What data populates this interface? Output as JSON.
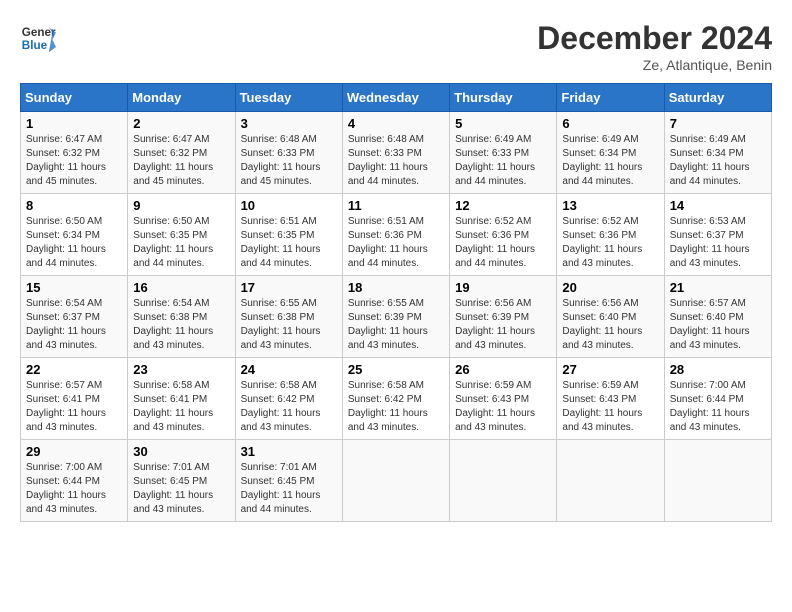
{
  "header": {
    "logo_line1": "General",
    "logo_line2": "Blue",
    "month_title": "December 2024",
    "subtitle": "Ze, Atlantique, Benin"
  },
  "days_of_week": [
    "Sunday",
    "Monday",
    "Tuesday",
    "Wednesday",
    "Thursday",
    "Friday",
    "Saturday"
  ],
  "weeks": [
    [
      {
        "day": "1",
        "detail": "Sunrise: 6:47 AM\nSunset: 6:32 PM\nDaylight: 11 hours\nand 45 minutes."
      },
      {
        "day": "2",
        "detail": "Sunrise: 6:47 AM\nSunset: 6:32 PM\nDaylight: 11 hours\nand 45 minutes."
      },
      {
        "day": "3",
        "detail": "Sunrise: 6:48 AM\nSunset: 6:33 PM\nDaylight: 11 hours\nand 45 minutes."
      },
      {
        "day": "4",
        "detail": "Sunrise: 6:48 AM\nSunset: 6:33 PM\nDaylight: 11 hours\nand 44 minutes."
      },
      {
        "day": "5",
        "detail": "Sunrise: 6:49 AM\nSunset: 6:33 PM\nDaylight: 11 hours\nand 44 minutes."
      },
      {
        "day": "6",
        "detail": "Sunrise: 6:49 AM\nSunset: 6:34 PM\nDaylight: 11 hours\nand 44 minutes."
      },
      {
        "day": "7",
        "detail": "Sunrise: 6:49 AM\nSunset: 6:34 PM\nDaylight: 11 hours\nand 44 minutes."
      }
    ],
    [
      {
        "day": "8",
        "detail": "Sunrise: 6:50 AM\nSunset: 6:34 PM\nDaylight: 11 hours\nand 44 minutes."
      },
      {
        "day": "9",
        "detail": "Sunrise: 6:50 AM\nSunset: 6:35 PM\nDaylight: 11 hours\nand 44 minutes."
      },
      {
        "day": "10",
        "detail": "Sunrise: 6:51 AM\nSunset: 6:35 PM\nDaylight: 11 hours\nand 44 minutes."
      },
      {
        "day": "11",
        "detail": "Sunrise: 6:51 AM\nSunset: 6:36 PM\nDaylight: 11 hours\nand 44 minutes."
      },
      {
        "day": "12",
        "detail": "Sunrise: 6:52 AM\nSunset: 6:36 PM\nDaylight: 11 hours\nand 44 minutes."
      },
      {
        "day": "13",
        "detail": "Sunrise: 6:52 AM\nSunset: 6:36 PM\nDaylight: 11 hours\nand 43 minutes."
      },
      {
        "day": "14",
        "detail": "Sunrise: 6:53 AM\nSunset: 6:37 PM\nDaylight: 11 hours\nand 43 minutes."
      }
    ],
    [
      {
        "day": "15",
        "detail": "Sunrise: 6:54 AM\nSunset: 6:37 PM\nDaylight: 11 hours\nand 43 minutes."
      },
      {
        "day": "16",
        "detail": "Sunrise: 6:54 AM\nSunset: 6:38 PM\nDaylight: 11 hours\nand 43 minutes."
      },
      {
        "day": "17",
        "detail": "Sunrise: 6:55 AM\nSunset: 6:38 PM\nDaylight: 11 hours\nand 43 minutes."
      },
      {
        "day": "18",
        "detail": "Sunrise: 6:55 AM\nSunset: 6:39 PM\nDaylight: 11 hours\nand 43 minutes."
      },
      {
        "day": "19",
        "detail": "Sunrise: 6:56 AM\nSunset: 6:39 PM\nDaylight: 11 hours\nand 43 minutes."
      },
      {
        "day": "20",
        "detail": "Sunrise: 6:56 AM\nSunset: 6:40 PM\nDaylight: 11 hours\nand 43 minutes."
      },
      {
        "day": "21",
        "detail": "Sunrise: 6:57 AM\nSunset: 6:40 PM\nDaylight: 11 hours\nand 43 minutes."
      }
    ],
    [
      {
        "day": "22",
        "detail": "Sunrise: 6:57 AM\nSunset: 6:41 PM\nDaylight: 11 hours\nand 43 minutes."
      },
      {
        "day": "23",
        "detail": "Sunrise: 6:58 AM\nSunset: 6:41 PM\nDaylight: 11 hours\nand 43 minutes."
      },
      {
        "day": "24",
        "detail": "Sunrise: 6:58 AM\nSunset: 6:42 PM\nDaylight: 11 hours\nand 43 minutes."
      },
      {
        "day": "25",
        "detail": "Sunrise: 6:58 AM\nSunset: 6:42 PM\nDaylight: 11 hours\nand 43 minutes."
      },
      {
        "day": "26",
        "detail": "Sunrise: 6:59 AM\nSunset: 6:43 PM\nDaylight: 11 hours\nand 43 minutes."
      },
      {
        "day": "27",
        "detail": "Sunrise: 6:59 AM\nSunset: 6:43 PM\nDaylight: 11 hours\nand 43 minutes."
      },
      {
        "day": "28",
        "detail": "Sunrise: 7:00 AM\nSunset: 6:44 PM\nDaylight: 11 hours\nand 43 minutes."
      }
    ],
    [
      {
        "day": "29",
        "detail": "Sunrise: 7:00 AM\nSunset: 6:44 PM\nDaylight: 11 hours\nand 43 minutes."
      },
      {
        "day": "30",
        "detail": "Sunrise: 7:01 AM\nSunset: 6:45 PM\nDaylight: 11 hours\nand 43 minutes."
      },
      {
        "day": "31",
        "detail": "Sunrise: 7:01 AM\nSunset: 6:45 PM\nDaylight: 11 hours\nand 44 minutes."
      },
      {
        "day": "",
        "detail": ""
      },
      {
        "day": "",
        "detail": ""
      },
      {
        "day": "",
        "detail": ""
      },
      {
        "day": "",
        "detail": ""
      }
    ]
  ]
}
